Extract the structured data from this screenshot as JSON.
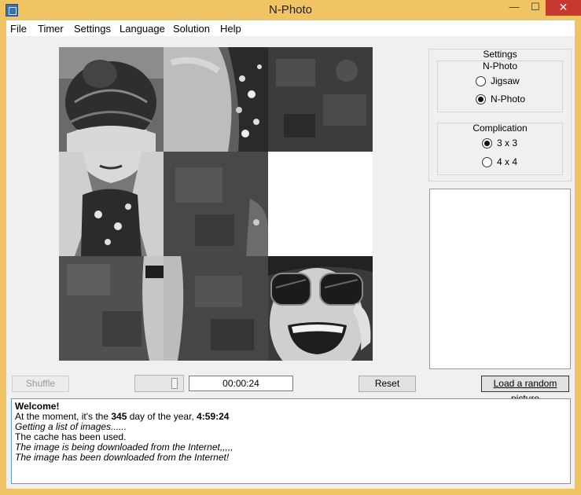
{
  "window": {
    "title": "N-Photo",
    "controls": {
      "minimize": "—",
      "maximize": "☐",
      "close": "✕"
    }
  },
  "menu": [
    "File",
    "Timer",
    "Settings",
    "Language",
    "Solution",
    "Help"
  ],
  "settings": {
    "title": "Settings",
    "mode": {
      "label": "N-Photo",
      "options": [
        {
          "label": "Jigsaw",
          "selected": false
        },
        {
          "label": "N-Photo",
          "selected": true
        }
      ]
    },
    "complication": {
      "label": "Complication",
      "options": [
        {
          "label": "3 x 3",
          "selected": true
        },
        {
          "label": "4 x 4",
          "selected": false
        }
      ]
    }
  },
  "controls": {
    "shuffle": "Shuffle",
    "timer": "00:00:24",
    "reset": "Reset",
    "load_random": "Load a random picture"
  },
  "log": {
    "welcome": "Welcome!",
    "line1_pre": "At the moment, it's the ",
    "day": "345",
    "line1_mid": " day of the year, ",
    "time": "4:59:24",
    "line2": "Getting a list of images......",
    "line3": "The cache has been used.",
    "line4": "The image is being downloaded from the Internet,,,,,",
    "line5": "The image has been downloaded from the Internet!"
  },
  "puzzle": {
    "grid": "3x3",
    "empty_tile": 6
  }
}
